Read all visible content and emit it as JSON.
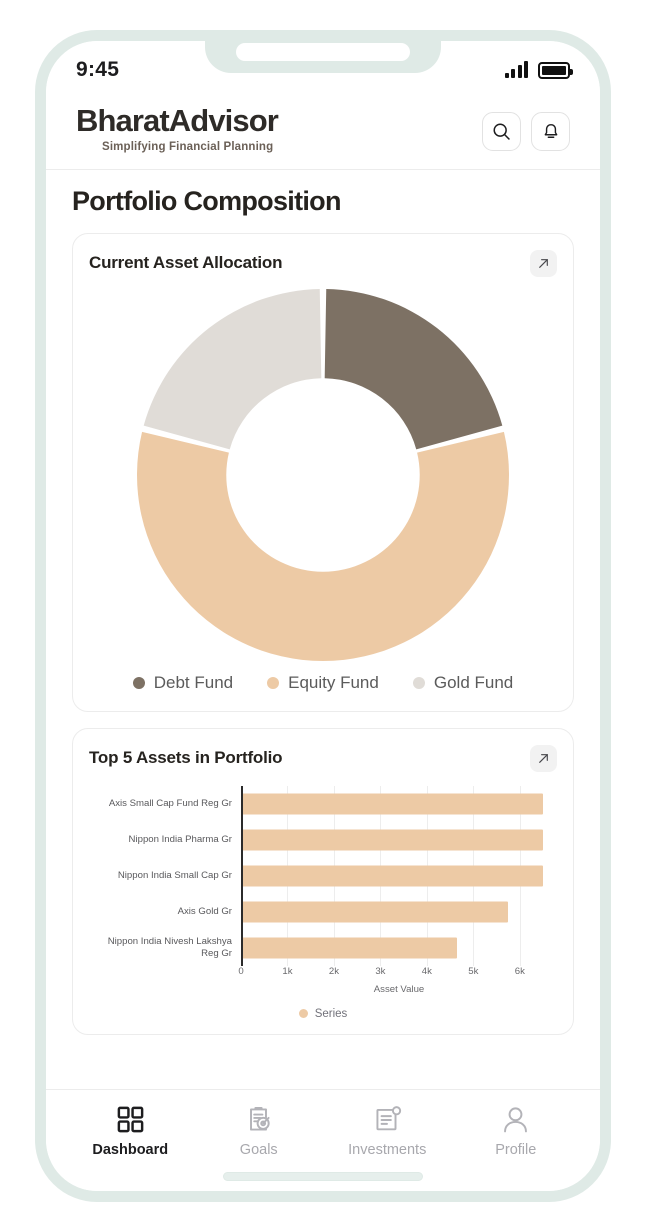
{
  "status_bar": {
    "time": "9:45",
    "signal_icon": "signal-bars-icon",
    "battery_icon": "battery-full-icon"
  },
  "header": {
    "brand": "BharatAdvisor",
    "tagline": "Simplifying Financial Planning",
    "search_icon": "search-icon",
    "notifications_icon": "bell-icon"
  },
  "page": {
    "title": "Portfolio Composition"
  },
  "allocation_card": {
    "title": "Current Asset Allocation",
    "expand_icon": "arrow-up-right-icon"
  },
  "assets_card": {
    "title": "Top 5 Assets in Portfolio",
    "expand_icon": "arrow-up-right-icon"
  },
  "bottom_nav": {
    "items": [
      {
        "label": "Dashboard",
        "icon": "grid-icon",
        "active": true
      },
      {
        "label": "Goals",
        "icon": "clipboard-target-icon",
        "active": false
      },
      {
        "label": "Investments",
        "icon": "document-icon",
        "active": false
      },
      {
        "label": "Profile",
        "icon": "person-icon",
        "active": false
      }
    ]
  },
  "chart_data": [
    {
      "type": "pie",
      "title": "Current Asset Allocation",
      "variant": "donut",
      "labels": [
        "Debt Fund",
        "Equity Fund",
        "Gold Fund"
      ],
      "values": [
        21,
        58,
        21
      ],
      "unit": "percent",
      "colors": [
        "#7d7164",
        "#edcaa5",
        "#e0dcd7"
      ],
      "legend_position": "bottom",
      "start_angle": 0,
      "inner_radius_ratio": 0.52
    },
    {
      "type": "bar",
      "orientation": "horizontal",
      "title": "Top 5 Assets in Portfolio",
      "categories": [
        "Axis Small Cap Fund Reg Gr",
        "Nippon India Pharma Gr",
        "Nippon India Small Cap Gr",
        "Axis Gold Gr",
        "Nippon India Nivesh Lakshya Reg Gr"
      ],
      "values": [
        6500,
        6500,
        6500,
        5750,
        4650
      ],
      "series": [
        {
          "name": "Series",
          "values": [
            6500,
            6500,
            6500,
            5750,
            4650
          ]
        }
      ],
      "xlabel": "Asset Value",
      "ylabel": "",
      "xlim": [
        0,
        6800
      ],
      "xticks": [
        0,
        1000,
        2000,
        3000,
        4000,
        5000,
        6000
      ],
      "xtick_labels": [
        "0",
        "1k",
        "2k",
        "3k",
        "4k",
        "5k",
        "6k"
      ],
      "grid": true,
      "legend_position": "bottom",
      "color": "#edcaa5"
    }
  ]
}
